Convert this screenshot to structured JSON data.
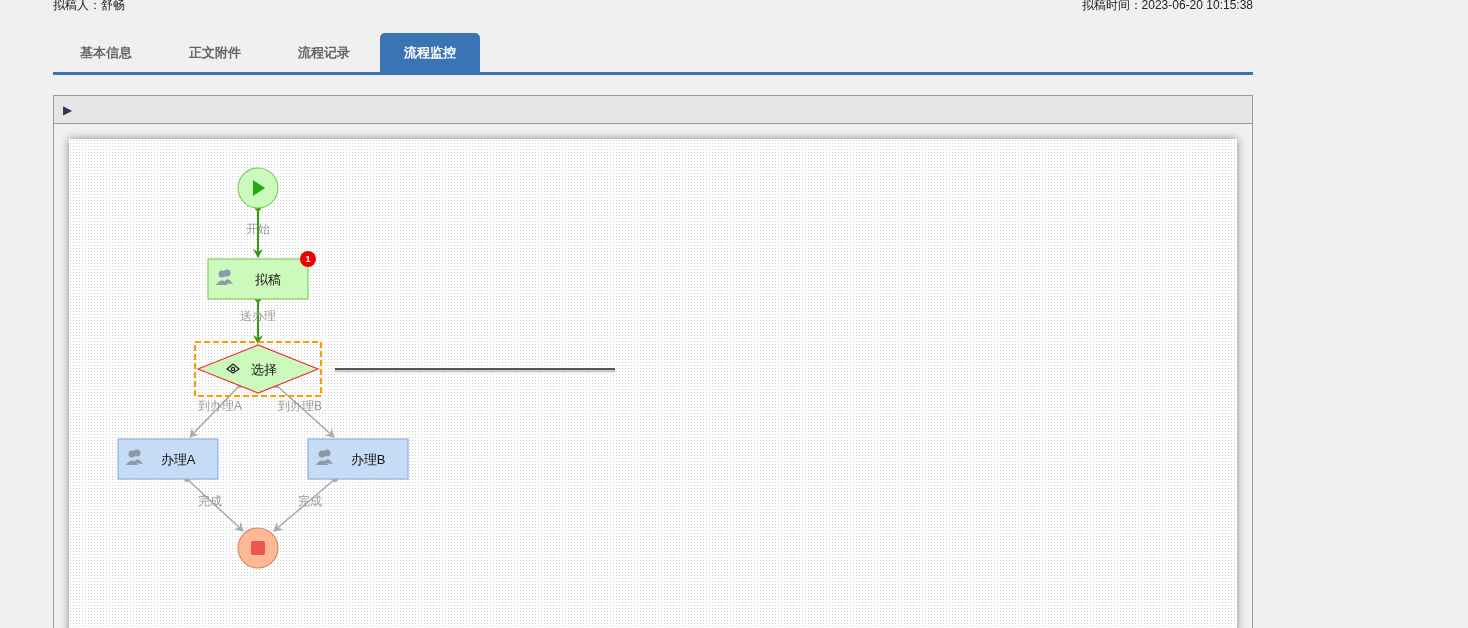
{
  "header": {
    "drafter": "拟稿人：舒畅",
    "draft_time": "拟稿时间：2023-06-20 10:15:38"
  },
  "tabs": [
    {
      "label": "基本信息",
      "selected": false
    },
    {
      "label": "正文附件",
      "selected": false
    },
    {
      "label": "流程记录",
      "selected": false
    },
    {
      "label": "流程监控",
      "selected": true
    }
  ],
  "toolbar": {
    "expand_toggle": "▶"
  },
  "flow": {
    "nodes": [
      {
        "kind": "start",
        "reached": true,
        "selected": false
      },
      {
        "kind": "task",
        "label": "拟稿",
        "reached": true,
        "badge": "1",
        "selected": false
      },
      {
        "kind": "gateway",
        "label": "选择",
        "reached": true,
        "selected": true
      },
      {
        "kind": "task",
        "label": "办理A",
        "reached": false,
        "selected": false
      },
      {
        "kind": "task",
        "label": "办理B",
        "reached": false,
        "selected": false
      },
      {
        "kind": "end",
        "reached": false,
        "selected": false
      }
    ],
    "edges": [
      {
        "label": "开始",
        "passed": true
      },
      {
        "label": "送办理",
        "passed": true
      },
      {
        "label": "到办理A",
        "passed": false
      },
      {
        "label": "到办理B",
        "passed": false
      },
      {
        "label": "完成",
        "passed": false
      },
      {
        "label": "完成",
        "passed": false
      }
    ]
  }
}
